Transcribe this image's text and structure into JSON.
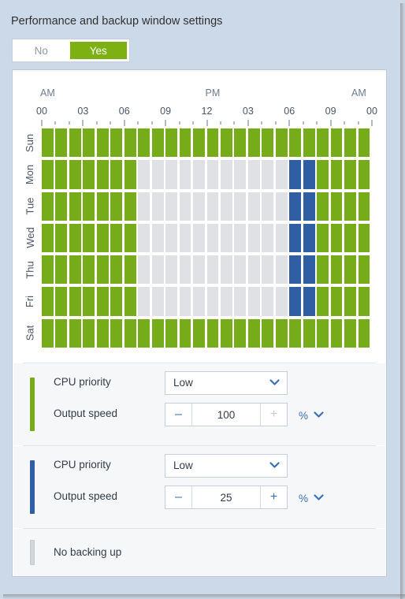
{
  "window": {
    "title": "Performance and backup window settings",
    "background_color": "#ccd9e9"
  },
  "toggle": {
    "name": "enable-backup-window-toggle",
    "options": [
      "No",
      "Yes"
    ],
    "selected": "Yes",
    "selected_color": "#7cb013"
  },
  "schedule": {
    "ampm_labels": [
      "AM",
      "PM",
      "AM"
    ],
    "hour_labels": [
      "00",
      "03",
      "06",
      "09",
      "12",
      "03",
      "06",
      "09",
      "00"
    ],
    "days": [
      "Sun",
      "Mon",
      "Tue",
      "Wed",
      "Thu",
      "Fri",
      "Sat"
    ],
    "legend_colors": {
      "green": "#76ab19",
      "blue": "#305ea3",
      "grey": "#dfe1e4"
    },
    "hours_per_day": 24,
    "rows": [
      {
        "day": "Sun",
        "cells": [
          "green",
          "green",
          "green",
          "green",
          "green",
          "green",
          "green",
          "green",
          "green",
          "green",
          "green",
          "green",
          "green",
          "green",
          "green",
          "green",
          "green",
          "green",
          "green",
          "green",
          "green",
          "green",
          "green",
          "green"
        ]
      },
      {
        "day": "Mon",
        "cells": [
          "green",
          "green",
          "green",
          "green",
          "green",
          "green",
          "green",
          "grey",
          "grey",
          "grey",
          "grey",
          "grey",
          "grey",
          "grey",
          "grey",
          "grey",
          "grey",
          "grey",
          "blue",
          "blue",
          "green",
          "green",
          "green",
          "green"
        ]
      },
      {
        "day": "Tue",
        "cells": [
          "green",
          "green",
          "green",
          "green",
          "green",
          "green",
          "green",
          "grey",
          "grey",
          "grey",
          "grey",
          "grey",
          "grey",
          "grey",
          "grey",
          "grey",
          "grey",
          "grey",
          "blue",
          "blue",
          "green",
          "green",
          "green",
          "green"
        ]
      },
      {
        "day": "Wed",
        "cells": [
          "green",
          "green",
          "green",
          "green",
          "green",
          "green",
          "green",
          "grey",
          "grey",
          "grey",
          "grey",
          "grey",
          "grey",
          "grey",
          "grey",
          "grey",
          "grey",
          "grey",
          "blue",
          "blue",
          "green",
          "green",
          "green",
          "green"
        ]
      },
      {
        "day": "Thu",
        "cells": [
          "green",
          "green",
          "green",
          "green",
          "green",
          "green",
          "green",
          "grey",
          "grey",
          "grey",
          "grey",
          "grey",
          "grey",
          "grey",
          "grey",
          "grey",
          "grey",
          "grey",
          "blue",
          "blue",
          "green",
          "green",
          "green",
          "green"
        ]
      },
      {
        "day": "Fri",
        "cells": [
          "green",
          "green",
          "green",
          "green",
          "green",
          "green",
          "green",
          "grey",
          "grey",
          "grey",
          "grey",
          "grey",
          "grey",
          "grey",
          "grey",
          "grey",
          "grey",
          "grey",
          "blue",
          "blue",
          "green",
          "green",
          "green",
          "green"
        ]
      },
      {
        "day": "Sat",
        "cells": [
          "green",
          "green",
          "green",
          "green",
          "green",
          "green",
          "green",
          "green",
          "green",
          "green",
          "green",
          "green",
          "green",
          "green",
          "green",
          "green",
          "green",
          "green",
          "green",
          "green",
          "green",
          "green",
          "green",
          "green"
        ]
      }
    ]
  },
  "panels": [
    {
      "name": "green-profile",
      "bar_color": "#76ab19",
      "cpu_priority_label": "CPU priority",
      "cpu_priority_value": "Low",
      "output_speed_label": "Output speed",
      "output_speed_value": "100",
      "unit": "%",
      "minus_label": "–",
      "plus_label": "+",
      "plus_disabled": true
    },
    {
      "name": "blue-profile",
      "bar_color": "#305ea3",
      "cpu_priority_label": "CPU priority",
      "cpu_priority_value": "Low",
      "output_speed_label": "Output speed",
      "output_speed_value": "25",
      "unit": "%",
      "minus_label": "–",
      "plus_label": "+",
      "plus_disabled": false
    }
  ],
  "no_backup": {
    "label": "No backing up",
    "bar_color": "#d3d6d9"
  }
}
